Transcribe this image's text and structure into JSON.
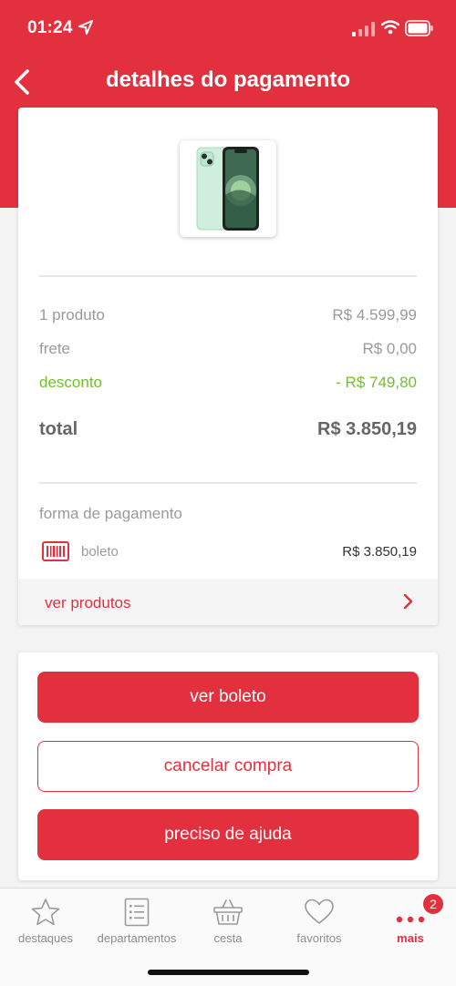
{
  "status_bar": {
    "time": "01:24"
  },
  "nav": {
    "title": "detalhes do pagamento"
  },
  "summary": {
    "products_label": "1 produto",
    "products_value": "R$ 4.599,99",
    "shipping_label": "frete",
    "shipping_value": "R$ 0,00",
    "discount_label": "desconto",
    "discount_value": "- R$ 749,80",
    "total_label": "total",
    "total_value": "R$ 3.850,19"
  },
  "payment": {
    "section_label": "forma de pagamento",
    "method": "boleto",
    "amount": "R$ 3.850,19"
  },
  "products_link": "ver produtos",
  "actions": {
    "view_boleto": "ver boleto",
    "cancel_purchase": "cancelar compra",
    "need_help": "preciso de ajuda"
  },
  "tab_bar": {
    "items": [
      {
        "label": "destaques",
        "icon": "star-icon"
      },
      {
        "label": "departamentos",
        "icon": "list-icon"
      },
      {
        "label": "cesta",
        "icon": "basket-icon"
      },
      {
        "label": "favoritos",
        "icon": "heart-icon"
      },
      {
        "label": "mais",
        "icon": "more-icon"
      }
    ],
    "badge_count": "2"
  },
  "colors": {
    "brand": "#e3303e",
    "discount": "#6fc02d"
  }
}
